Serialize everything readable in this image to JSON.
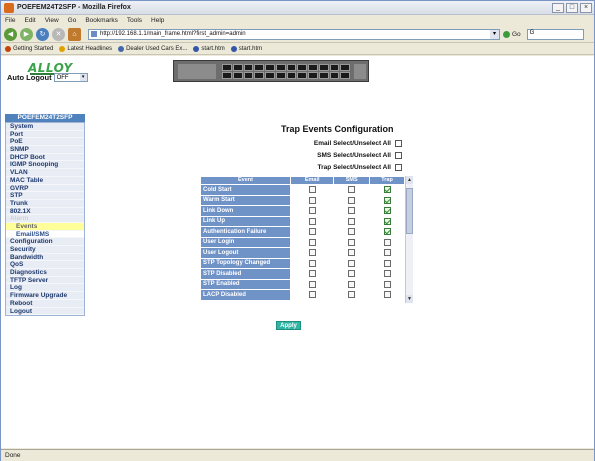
{
  "window": {
    "title": "POEFEM24T2SFP - Mozilla Firefox",
    "min": "_",
    "max": "□",
    "close": "×"
  },
  "menubar": [
    "File",
    "Edit",
    "View",
    "Go",
    "Bookmarks",
    "Tools",
    "Help"
  ],
  "nav": {
    "back": "◀",
    "forward": "▶",
    "reload": "↻",
    "stop": "✕",
    "home": "⌂",
    "url": "http://192.168.1.1/main_frame.html?first_admin=admin",
    "go": "Go",
    "search_label": "G"
  },
  "bookmarks": [
    {
      "label": "Getting Started",
      "color": "#c2410c"
    },
    {
      "label": "Latest Headlines",
      "color": "#e0a100"
    },
    {
      "label": "Dealer Used Cars Ex...",
      "color": "#4466aa"
    },
    {
      "label": "start.htm",
      "color": "#3355aa"
    },
    {
      "label": "start.htm",
      "color": "#3355aa"
    }
  ],
  "brand": {
    "logo": "ALLOY"
  },
  "auto_logout": {
    "label": "Auto Logout",
    "value": "OFF",
    "arrow": "▾"
  },
  "sidebar": {
    "model": "POEFEM24T2SFP",
    "items": [
      {
        "label": "System",
        "kind": "item"
      },
      {
        "label": "Port",
        "kind": "item"
      },
      {
        "label": "PoE",
        "kind": "item"
      },
      {
        "label": "SNMP",
        "kind": "item"
      },
      {
        "label": "DHCP Boot",
        "kind": "item"
      },
      {
        "label": "IGMP Snooping",
        "kind": "item"
      },
      {
        "label": "VLAN",
        "kind": "item"
      },
      {
        "label": "MAC Table",
        "kind": "item"
      },
      {
        "label": "GVRP",
        "kind": "item"
      },
      {
        "label": "STP",
        "kind": "item"
      },
      {
        "label": "Trunk",
        "kind": "item"
      },
      {
        "label": "802.1X",
        "kind": "item"
      },
      {
        "label": "Alarm",
        "kind": "active"
      },
      {
        "label": "Events",
        "kind": "sub-selected"
      },
      {
        "label": "Email/SMS",
        "kind": "sub"
      },
      {
        "label": "Configuration",
        "kind": "item"
      },
      {
        "label": "Security",
        "kind": "item"
      },
      {
        "label": "Bandwidth",
        "kind": "item"
      },
      {
        "label": "QoS",
        "kind": "item"
      },
      {
        "label": "Diagnostics",
        "kind": "item"
      },
      {
        "label": "TFTP Server",
        "kind": "item"
      },
      {
        "label": "Log",
        "kind": "item"
      },
      {
        "label": "Firmware Upgrade",
        "kind": "item"
      },
      {
        "label": "Reboot",
        "kind": "item"
      },
      {
        "label": "Logout",
        "kind": "item"
      }
    ]
  },
  "page": {
    "title": "Trap Events Configuration",
    "select_all": [
      {
        "label": "Email Select/Unselect All",
        "checked": false
      },
      {
        "label": "SMS Select/Unselect All",
        "checked": false
      },
      {
        "label": "Trap Select/Unselect All",
        "checked": false
      }
    ],
    "columns": [
      "Event",
      "Email",
      "SMS",
      "Trap"
    ],
    "rows": [
      {
        "event": "Cold Start",
        "email": false,
        "sms": false,
        "trap": true
      },
      {
        "event": "Warm Start",
        "email": false,
        "sms": false,
        "trap": true
      },
      {
        "event": "Link Down",
        "email": false,
        "sms": false,
        "trap": true
      },
      {
        "event": "Link Up",
        "email": false,
        "sms": false,
        "trap": true
      },
      {
        "event": "Authentication Failure",
        "email": false,
        "sms": false,
        "trap": true
      },
      {
        "event": "User Login",
        "email": false,
        "sms": false,
        "trap": false
      },
      {
        "event": "User Logout",
        "email": false,
        "sms": false,
        "trap": false
      },
      {
        "event": "STP Topology Changed",
        "email": false,
        "sms": false,
        "trap": false
      },
      {
        "event": "STP Disabled",
        "email": false,
        "sms": false,
        "trap": false
      },
      {
        "event": "STP Enabled",
        "email": false,
        "sms": false,
        "trap": false
      },
      {
        "event": "LACP Disabled",
        "email": false,
        "sms": false,
        "trap": false
      }
    ],
    "scroll_up": "▲",
    "scroll_down": "▼",
    "apply_label": "Apply"
  },
  "status": {
    "text": "Done"
  }
}
